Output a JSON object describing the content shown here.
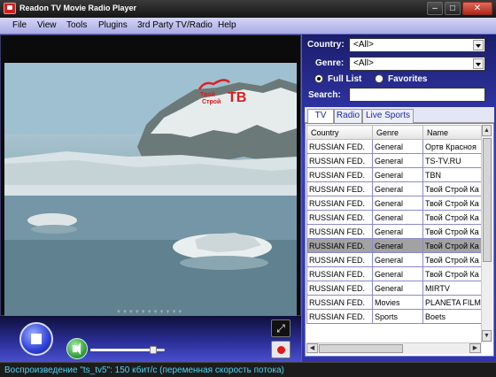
{
  "window": {
    "title": "Readon TV Movie Radio Player"
  },
  "menu": [
    "File",
    "View",
    "Tools",
    "Plugins",
    "3rd Party TV/Radio",
    "Help"
  ],
  "video": {
    "logo": "ТВ"
  },
  "filters": {
    "country_label": "Country:",
    "country_value": "<All>",
    "genre_label": "Genre:",
    "genre_value": "<All>",
    "full_list_label": "Full List",
    "favorites_label": "Favorites",
    "search_label": "Search:",
    "search_value": ""
  },
  "tabs": [
    "TV",
    "Radio",
    "Live Sports"
  ],
  "channel_table": {
    "columns": [
      "Country",
      "Genre",
      "Name"
    ],
    "rows": [
      [
        "RUSSIAN FED.",
        "General",
        "Ортв Красноя"
      ],
      [
        "RUSSIAN FED.",
        "General",
        "TS-TV.RU"
      ],
      [
        "RUSSIAN FED.",
        "General",
        "TBN"
      ],
      [
        "RUSSIAN FED.",
        "General",
        "Твой Строй Ка"
      ],
      [
        "RUSSIAN FED.",
        "General",
        "Твой Строй Ка"
      ],
      [
        "RUSSIAN FED.",
        "General",
        "Твой Строй Ка"
      ],
      [
        "RUSSIAN FED.",
        "General",
        "Твой Строй Ка"
      ],
      [
        "RUSSIAN FED.",
        "General",
        "Твой Строй Ка"
      ],
      [
        "RUSSIAN FED.",
        "General",
        "Твой Строй Ка"
      ],
      [
        "RUSSIAN FED.",
        "General",
        "Твой Строй Ка"
      ],
      [
        "RUSSIAN FED.",
        "General",
        "MIRTV"
      ],
      [
        "RUSSIAN FED.",
        "Movies",
        "PLANETA FILM"
      ],
      [
        "RUSSIAN FED.",
        "Sports",
        "Boets"
      ]
    ],
    "selected_index": 7
  },
  "volume_level": 0.85,
  "status": "Воспроизведение \"ts_tv5\": 150 кбит/с (переменная скорость потока)",
  "colors": {
    "panel_blue": "#3a3fbf",
    "status_text": "#4ed6f2",
    "menu_bg": "#c4c6f0"
  }
}
